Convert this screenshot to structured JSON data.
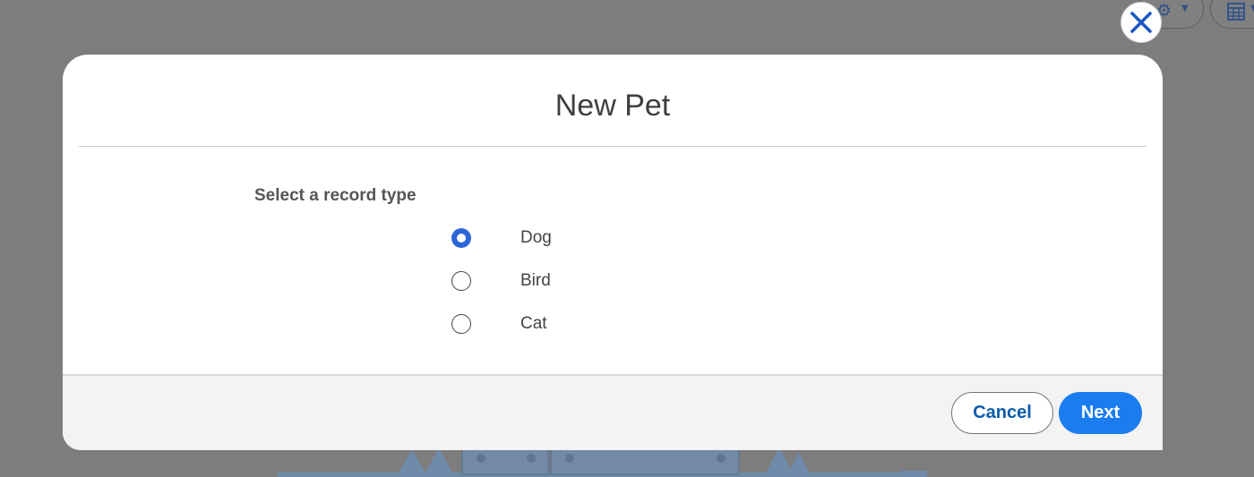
{
  "modal": {
    "title": "New Pet",
    "close_icon": "close-icon",
    "record_type_label": "Select a record type",
    "options": [
      {
        "label": "Dog",
        "selected": true
      },
      {
        "label": "Bird",
        "selected": false
      },
      {
        "label": "Cat",
        "selected": false
      }
    ],
    "cancel_label": "Cancel",
    "next_label": "Next"
  },
  "background": {
    "icons": [
      "gear-icon",
      "chevron-down-icon",
      "table-icon",
      "chevron-down-icon"
    ]
  },
  "colors": {
    "accent": "#1b7cf0",
    "radio_selected": "#2c65d6",
    "link_text": "#0b5cab",
    "overlay": "#7d7d7d",
    "close_x": "#1a56c4"
  }
}
